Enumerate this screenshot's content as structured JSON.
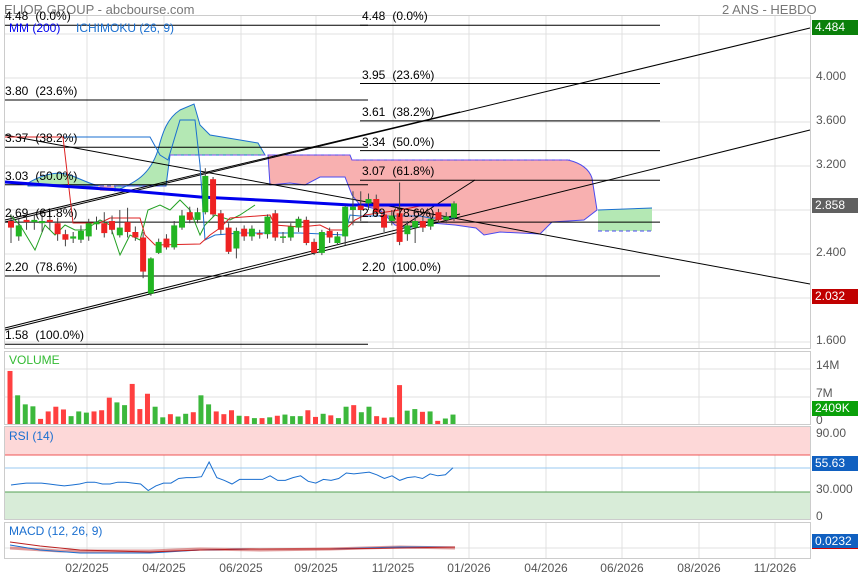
{
  "header": {
    "title": "ELIOR GROUP - abcbourse.com",
    "period": "2 ANS - HEBDO"
  },
  "legend": {
    "ma": "MM (200)",
    "ichimoku": "ICHIMOKU (26, 9)"
  },
  "panels": {
    "volume": "VOLUME",
    "rsi": "RSI (14)",
    "macd": "MACD (12, 26, 9)"
  },
  "colors": {
    "up": "#22b522",
    "down": "#ee2222",
    "ma": "#0000ee",
    "ichimoku": "#1a6fd0"
  },
  "price_axis": [
    "4.000",
    "3.600",
    "3.200",
    "2.400",
    "1.600"
  ],
  "volume_axis": [
    "14M",
    "7M",
    "0"
  ],
  "rsi_axis": [
    "90.00",
    "30.000",
    "0"
  ],
  "badges": {
    "high": "4.484",
    "last": "2.858",
    "low": "2.032",
    "volume": "2409K",
    "rsi": "55.63",
    "macd": "0.0232"
  },
  "x_axis": [
    "02/2025",
    "04/2025",
    "06/2025",
    "09/2025",
    "11/2025",
    "01/2026",
    "04/2026",
    "06/2026",
    "08/2026",
    "11/2026"
  ],
  "fib_left": [
    {
      "price": "4.48",
      "pct": "(0.0%)",
      "v": 4.48
    },
    {
      "price": "3.80",
      "pct": "(23.6%)",
      "v": 3.8
    },
    {
      "price": "3.37",
      "pct": "(38.2%)",
      "v": 3.37
    },
    {
      "price": "3.03",
      "pct": "(50.0%)",
      "v": 3.03
    },
    {
      "price": "2.69",
      "pct": "(61.8%)",
      "v": 2.69
    },
    {
      "price": "2.20",
      "pct": "(78.6%)",
      "v": 2.2
    },
    {
      "price": "1.58",
      "pct": "(100.0%)",
      "v": 1.58
    }
  ],
  "fib_right": [
    {
      "price": "4.48",
      "pct": "(0.0%)",
      "v": 4.48
    },
    {
      "price": "3.95",
      "pct": "(23.6%)",
      "v": 3.95
    },
    {
      "price": "3.61",
      "pct": "(38.2%)",
      "v": 3.61
    },
    {
      "price": "3.34",
      "pct": "(50.0%)",
      "v": 3.34
    },
    {
      "price": "3.07",
      "pct": "(61.8%)",
      "v": 3.07
    },
    {
      "price": "2.69",
      "pct": "(78.6%)",
      "v": 2.69
    },
    {
      "price": "2.20",
      "pct": "(100.0%)",
      "v": 2.2
    }
  ],
  "chart_data": {
    "type": "candlestick",
    "ohlc": [
      [
        2.7,
        2.76,
        2.5,
        2.64
      ],
      [
        2.56,
        2.72,
        2.52,
        2.66
      ],
      [
        2.71,
        2.74,
        2.62,
        2.69
      ],
      [
        2.69,
        2.75,
        2.62,
        2.71
      ],
      [
        2.68,
        2.76,
        2.6,
        2.7
      ],
      [
        2.71,
        2.78,
        2.62,
        2.69
      ],
      [
        2.68,
        2.73,
        2.52,
        2.58
      ],
      [
        2.58,
        2.62,
        2.47,
        2.53
      ],
      [
        2.54,
        2.6,
        2.5,
        2.56
      ],
      [
        2.53,
        2.66,
        2.5,
        2.61
      ],
      [
        2.56,
        2.72,
        2.52,
        2.68
      ],
      [
        2.67,
        2.74,
        2.62,
        2.69
      ],
      [
        2.68,
        2.78,
        2.55,
        2.59
      ],
      [
        2.7,
        2.75,
        2.58,
        2.62
      ],
      [
        2.57,
        2.8,
        2.55,
        2.64
      ],
      [
        2.69,
        2.82,
        2.55,
        2.6
      ],
      [
        2.6,
        2.65,
        2.52,
        2.55
      ],
      [
        2.55,
        2.6,
        2.18,
        2.24
      ],
      [
        2.04,
        2.37,
        2.02,
        2.36
      ],
      [
        2.41,
        2.54,
        2.4,
        2.51
      ],
      [
        2.54,
        2.58,
        2.44,
        2.46
      ],
      [
        2.46,
        2.7,
        2.44,
        2.66
      ],
      [
        2.64,
        2.8,
        2.62,
        2.75
      ],
      [
        2.78,
        2.83,
        2.68,
        2.71
      ],
      [
        2.71,
        2.82,
        2.68,
        2.78
      ],
      [
        2.78,
        3.18,
        2.76,
        3.11
      ],
      [
        3.08,
        3.1,
        2.74,
        2.76
      ],
      [
        2.77,
        2.8,
        2.58,
        2.62
      ],
      [
        2.64,
        2.68,
        2.4,
        2.42
      ],
      [
        2.45,
        2.64,
        2.36,
        2.61
      ],
      [
        2.63,
        2.66,
        2.52,
        2.56
      ],
      [
        2.56,
        2.66,
        2.52,
        2.63
      ],
      [
        2.59,
        2.62,
        2.54,
        2.58
      ],
      [
        2.58,
        2.76,
        2.54,
        2.74
      ],
      [
        2.77,
        2.8,
        2.52,
        2.55
      ],
      [
        2.55,
        2.6,
        2.5,
        2.56
      ],
      [
        2.55,
        2.68,
        2.52,
        2.65
      ],
      [
        2.64,
        2.74,
        2.6,
        2.72
      ],
      [
        2.71,
        2.74,
        2.48,
        2.5
      ],
      [
        2.51,
        2.54,
        2.39,
        2.41
      ],
      [
        2.41,
        2.62,
        2.39,
        2.6
      ],
      [
        2.61,
        2.64,
        2.5,
        2.55
      ],
      [
        2.5,
        2.6,
        2.48,
        2.56
      ],
      [
        2.56,
        2.84,
        2.48,
        2.83
      ],
      [
        2.8,
        2.97,
        2.66,
        2.83
      ],
      [
        2.84,
        2.97,
        2.7,
        2.8
      ],
      [
        2.86,
        2.95,
        2.8,
        2.9
      ],
      [
        2.9,
        2.94,
        2.75,
        2.78
      ],
      [
        2.76,
        2.8,
        2.6,
        2.64
      ],
      [
        2.7,
        2.8,
        2.66,
        2.75
      ],
      [
        2.77,
        3.05,
        2.48,
        2.51
      ],
      [
        2.58,
        2.7,
        2.52,
        2.66
      ],
      [
        2.64,
        2.74,
        2.5,
        2.7
      ],
      [
        2.7,
        2.74,
        2.6,
        2.64
      ],
      [
        2.65,
        2.76,
        2.62,
        2.72
      ],
      [
        2.78,
        2.81,
        2.68,
        2.71
      ],
      [
        2.71,
        2.78,
        2.68,
        2.74
      ],
      [
        2.73,
        2.88,
        2.7,
        2.86
      ]
    ],
    "volume_m": [
      13.5,
      7.3,
      5.0,
      4.5,
      1.3,
      3.2,
      4.4,
      3.7,
      2.0,
      3.2,
      2.9,
      3.2,
      3.5,
      6.7,
      5.5,
      4.8,
      10.2,
      3.8,
      7.7,
      4.4,
      1.7,
      2.5,
      1.9,
      2.6,
      3.0,
      7.3,
      5.0,
      3.2,
      2.5,
      3.5,
      2.1,
      2.0,
      1.5,
      1.5,
      1.7,
      2.1,
      2.4,
      2.0,
      2.0,
      3.5,
      1.8,
      2.6,
      2.2,
      1.5,
      4.4,
      4.8,
      3.0,
      4.4,
      2.0,
      1.6,
      1.7,
      9.9,
      3.4,
      3.8,
      3.1,
      3.2,
      0.8,
      1.4,
      2.4
    ],
    "volume_up": [
      0,
      1,
      1,
      1,
      0,
      0,
      0,
      0,
      1,
      1,
      1,
      0,
      0,
      0,
      1,
      1,
      0,
      0,
      0,
      1,
      1,
      0,
      1,
      1,
      0,
      1,
      1,
      0,
      0,
      0,
      1,
      0,
      1,
      0,
      1,
      0,
      1,
      1,
      1,
      0,
      0,
      1,
      0,
      1,
      1,
      0,
      1,
      1,
      0,
      0,
      1,
      0,
      1,
      1,
      0,
      1,
      0,
      1,
      1
    ],
    "rsi": [
      37,
      38,
      39,
      39,
      39,
      38,
      37,
      36,
      37,
      38,
      40,
      40,
      38,
      38,
      40,
      40,
      39,
      38,
      31,
      36,
      39,
      39,
      44,
      45,
      45,
      46,
      62,
      45,
      42,
      38,
      43,
      43,
      43,
      43,
      47,
      42,
      42,
      45,
      47,
      41,
      39,
      43,
      42,
      44,
      50,
      49,
      50,
      51,
      48,
      44,
      47,
      42,
      45,
      46,
      44,
      49,
      47,
      48,
      55.6
    ],
    "price_range": [
      1.6,
      4.4
    ],
    "rsi_levels": [
      30,
      70
    ]
  }
}
